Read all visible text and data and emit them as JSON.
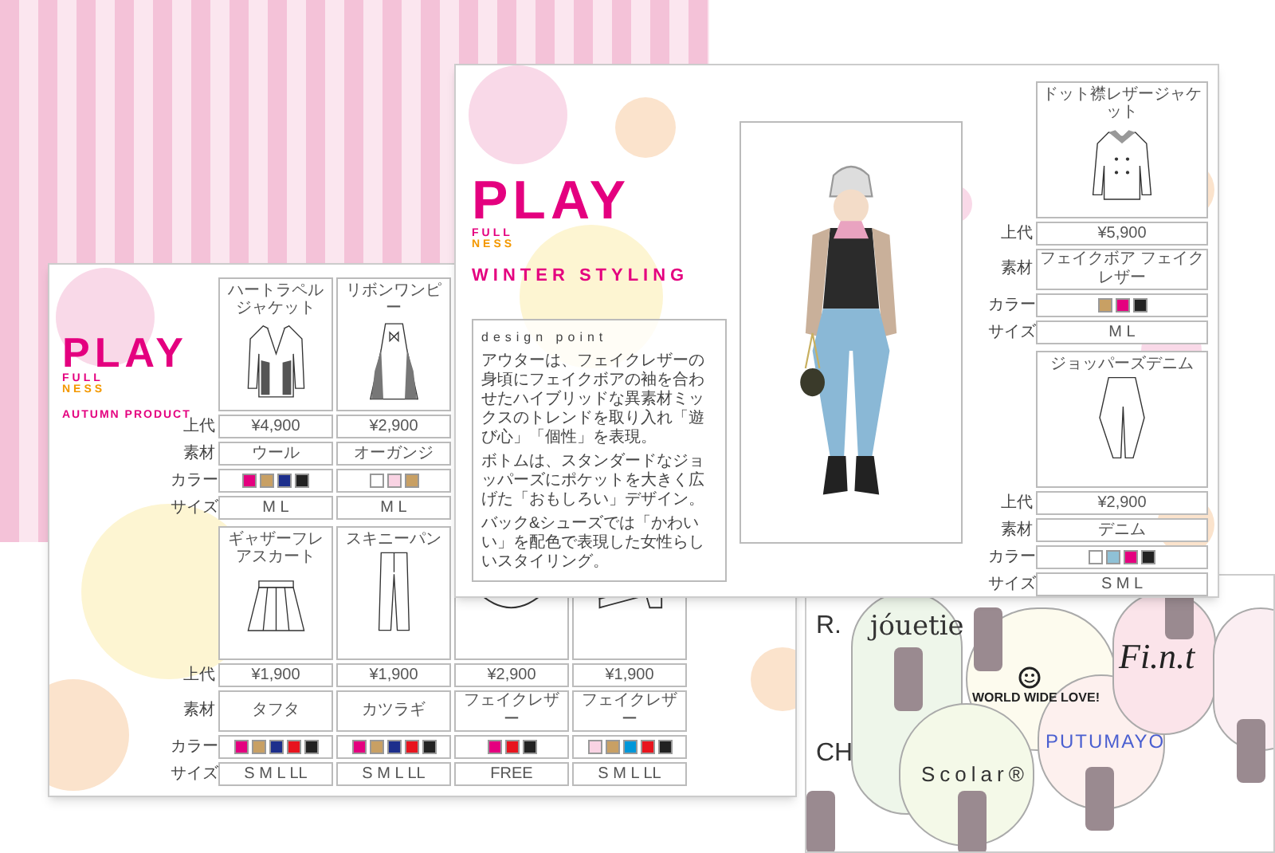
{
  "autumn_sheet": {
    "logo": {
      "word": "PLAY",
      "line_1": "FULL",
      "line_2": "NESS"
    },
    "subtitle": "AUTUMN PRODUCT",
    "blocks": [
      {
        "row_labels": [
          "上代",
          "素材",
          "カラー",
          "サイズ"
        ],
        "items": [
          {
            "kind": "jacket",
            "title": "ハートラペルジャケット",
            "price": "¥4,900",
            "material": "ウール",
            "colors": [
              {
                "color": "#e4007f"
              },
              {
                "color": "#c8a064"
              },
              {
                "color": "#1d2f8c"
              },
              {
                "color": "#222222"
              }
            ],
            "size": "M L"
          },
          {
            "kind": "dress",
            "title": "リボンワンピー",
            "price": "¥2,900",
            "material": "オーガンジ",
            "colors": [
              {
                "color": "#ffffff"
              },
              {
                "color": "#f9d3e3"
              },
              {
                "color": "#c8a064"
              }
            ],
            "size": "M L"
          }
        ]
      },
      {
        "row_labels": [
          "上代",
          "素材",
          "カラー",
          "サイズ"
        ],
        "items": [
          {
            "kind": "skirt",
            "title": "ギャザーフレアスカート",
            "price": "¥1,900",
            "material": "タフタ",
            "colors": [
              {
                "color": "#e4007f"
              },
              {
                "color": "#c8a064"
              },
              {
                "color": "#1d2f8c"
              },
              {
                "color": "#e8141e"
              },
              {
                "color": "#222222"
              }
            ],
            "size": "S M L LL"
          },
          {
            "kind": "jeans",
            "title": "スキニーパン",
            "price": "¥1,900",
            "material": "カツラギ",
            "colors": [
              {
                "color": "#e4007f"
              },
              {
                "color": "#c8a064"
              },
              {
                "color": "#1d2f8c"
              },
              {
                "color": "#e8141e"
              },
              {
                "color": "#222222"
              }
            ],
            "size": "S M L LL"
          },
          {
            "kind": "bag",
            "price": "¥2,900",
            "material": "フェイクレザー",
            "colors": [
              {
                "color": "#e4007f"
              },
              {
                "color": "#e8141e"
              },
              {
                "color": "#222222"
              }
            ],
            "size": "FREE"
          },
          {
            "kind": "shoe",
            "price": "¥1,900",
            "material": "フェイクレザー",
            "colors": [
              {
                "color": "#f9d3e3"
              },
              {
                "color": "#c8a064"
              },
              {
                "color": "#0097d9"
              },
              {
                "color": "#e8141e"
              },
              {
                "color": "#222222"
              }
            ],
            "size": "S M L LL"
          }
        ]
      }
    ]
  },
  "winter_sheet": {
    "logo": {
      "word": "PLAY",
      "line_1": "FULL",
      "line_2": "NESS"
    },
    "subtitle": "WINTER STYLING",
    "design_point": {
      "heading": "design point",
      "paragraphs": [
        "アウターは、フェイクレザーの身頃にフェイクボアの袖を合わせたハイブリッドな異素材ミックスのトレンドを取り入れ「遊び心」「個性」を表現。",
        "ボトムは、スタンダードなジョッパーズにポケットを大きく広げた「おもしろい」デザイン。",
        "バック&シューズでは「かわいい」を配色で表現した女性らしいスタイリング。"
      ]
    },
    "blocks": [
      {
        "row_labels": [
          "上代",
          "素材",
          "カラー",
          "サイズ"
        ],
        "items": [
          {
            "kind": "coat",
            "title": "ドット襟レザージャケット",
            "price": "¥5,900",
            "material": "フェイクボア フェイクレザー",
            "colors": [
              {
                "color": "#c8a064"
              },
              {
                "color": "#e4007f"
              },
              {
                "color": "#222222"
              }
            ],
            "size": "M L"
          }
        ]
      },
      {
        "row_labels": [
          "上代",
          "素材",
          "カラー",
          "サイズ"
        ],
        "items": [
          {
            "kind": "pants",
            "title": "ジョッパーズデニム",
            "price": "¥2,900",
            "material": "デニム",
            "colors": [
              {
                "color": "#ffffff"
              },
              {
                "color": "#8fc1d6"
              },
              {
                "color": "#e4007f"
              },
              {
                "color": "#222222"
              }
            ],
            "size": "S M L"
          }
        ]
      }
    ]
  },
  "brand_map": {
    "brands": [
      {
        "kind": "plain",
        "name": "R."
      },
      {
        "kind": "serif",
        "name": "jóuetie"
      },
      {
        "kind": "bold",
        "name": "WORLD WIDE LOVE!"
      },
      {
        "kind": "script",
        "name": "Fi.n.t"
      },
      {
        "kind": "blue",
        "name": "PUTUMAYO"
      },
      {
        "kind": "wide",
        "name": "Scolar®"
      },
      {
        "kind": "plain",
        "name": "CH"
      }
    ]
  }
}
